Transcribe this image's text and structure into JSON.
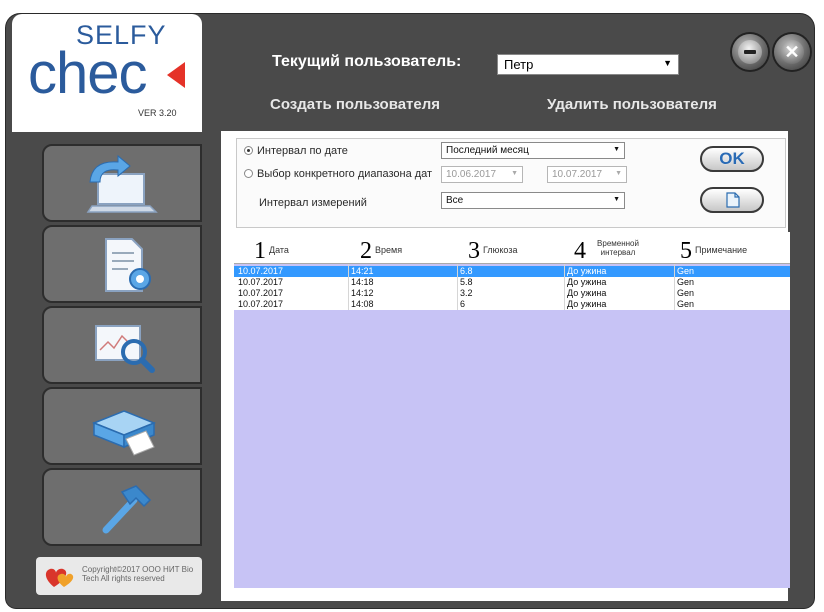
{
  "app": {
    "logo_selfy": "SELFY",
    "logo_check": "chec",
    "version": "VER 3.20",
    "copyright": "Copyright©2017 ООО НИТ Bio Tech All rights reserved"
  },
  "header": {
    "current_user_label": "Текущий пользователь:",
    "current_user_value": "Петр",
    "create_user": "Создать пользователя",
    "delete_user": "Удалить пользователя"
  },
  "nav": {
    "items": [
      {
        "name": "sync",
        "icon": "laptop-arrow-icon"
      },
      {
        "name": "settings",
        "icon": "document-gear-icon"
      },
      {
        "name": "analysis",
        "icon": "chart-magnifier-icon"
      },
      {
        "name": "print",
        "icon": "printer-icon"
      },
      {
        "name": "tools",
        "icon": "hammer-icon"
      }
    ]
  },
  "filter": {
    "by_date_label": "Интервал по дате",
    "by_date_value": "Последний месяц",
    "range_label": "Выбор конкретного диапазона дат",
    "range_from": "10.06.2017",
    "range_to": "10.07.2017",
    "measure_interval_label": "Интервал измерений",
    "measure_interval_value": "Все",
    "ok_label": "OK"
  },
  "table": {
    "columns": [
      {
        "num": "1",
        "label": "Дата"
      },
      {
        "num": "2",
        "label": "Время"
      },
      {
        "num": "3",
        "label": "Глюкоза"
      },
      {
        "num": "4",
        "label": "Временной интервал"
      },
      {
        "num": "5",
        "label": "Примечание"
      }
    ],
    "rows": [
      {
        "date": "10.07.2017",
        "time": "14:21",
        "glucose": "6.8",
        "interval": "До ужина",
        "note": "Gen"
      },
      {
        "date": "10.07.2017",
        "time": "14:18",
        "glucose": "5.8",
        "interval": "До ужина",
        "note": "Gen"
      },
      {
        "date": "10.07.2017",
        "time": "14:12",
        "glucose": "3.2",
        "interval": "До ужина",
        "note": "Gen"
      },
      {
        "date": "10.07.2017",
        "time": "14:08",
        "glucose": "6",
        "interval": "До ужина",
        "note": "Gen"
      }
    ]
  },
  "colors": {
    "accent": "#2b5b9c",
    "selection": "#3399ff",
    "table_bg": "#c7c3f5",
    "dark_frame": "#4a4a4a"
  }
}
